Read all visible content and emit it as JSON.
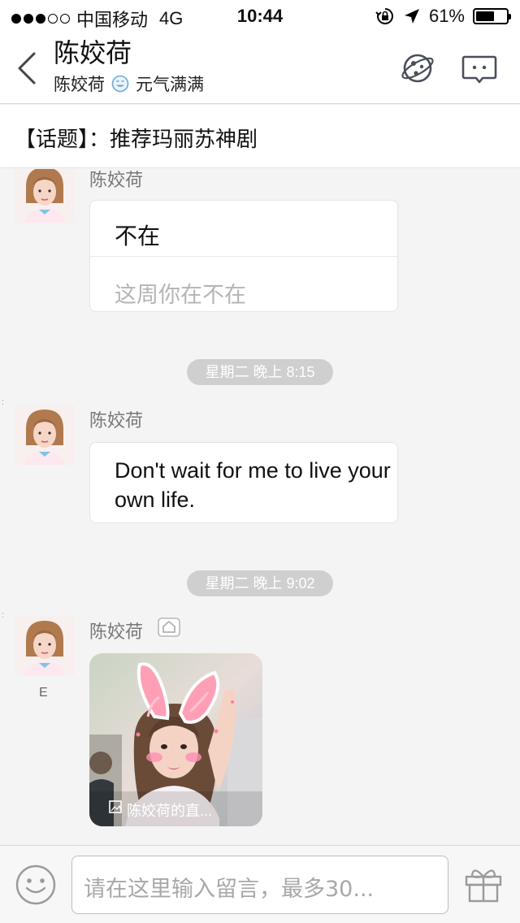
{
  "status_bar": {
    "carrier": "中国移动",
    "network": "4G",
    "time": "10:44",
    "battery_text": "61%",
    "battery_level": 0.61
  },
  "header": {
    "title": "陈姣荷",
    "subtitle_name": "陈姣荷",
    "subtitle_status": "元气满满"
  },
  "topic": {
    "text": "【话题】：推荐玛丽苏神剧"
  },
  "messages": [
    {
      "sender": "陈姣荷",
      "reply_text": "不在",
      "quoted_text": "这周你在不在"
    },
    {
      "timestamp": "星期二 晚上 8:15",
      "sender": "陈姣荷",
      "text": "Don't wait for me to live your own life."
    },
    {
      "timestamp": "星期二 晚上 9:02",
      "sender": "陈姣荷",
      "avatar_caption": "E",
      "image_caption": "陈姣荷的直..."
    }
  ],
  "input": {
    "placeholder": "请在这里输入留言，最多30..."
  },
  "colors": {
    "timestamp_pill": "#cfcfcf",
    "bunny_ears": "#ff9fb6",
    "icon_stroke": "#4a4f5a"
  }
}
